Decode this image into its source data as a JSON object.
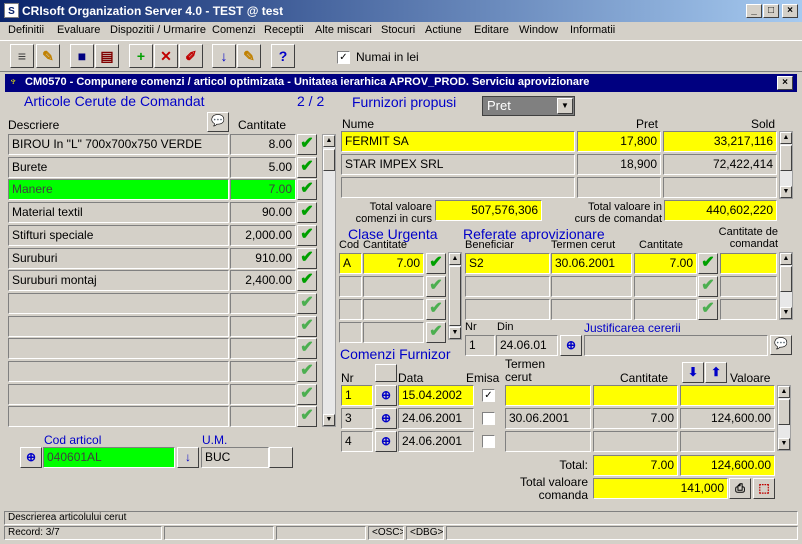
{
  "window": {
    "title": "CRIsoft Organization Server 4.0 - TEST @ test"
  },
  "menu": [
    "Definitii",
    "Evaluare",
    "Dispozitii / Urmarire",
    "Comenzi",
    "Receptii",
    "Alte miscari",
    "Stocuri",
    "Actiune",
    "Editare",
    "Window",
    "Informatii"
  ],
  "toolbar": {
    "numai_label": "Numai in lei",
    "numai_checked": "✓"
  },
  "form": {
    "title": "CM0570 - Compunere comenzi / articol optimizata - Unitatea ierarhica APROV_PROD. Serviciu aprovizionare"
  },
  "articole": {
    "title": "Articole Cerute de Comandat",
    "page": "2 / 2",
    "col_desc": "Descriere",
    "col_qty": "Cantitate",
    "rows": [
      {
        "d": "BIROU In \"L\" 700x700x750 VERDE",
        "q": "8.00"
      },
      {
        "d": "Burete",
        "q": "5.00"
      },
      {
        "d": "Manere",
        "q": "7.00"
      },
      {
        "d": "Material textil",
        "q": "90.00"
      },
      {
        "d": "Stifturi speciale",
        "q": "2,000.00"
      },
      {
        "d": "Suruburi",
        "q": "910.00"
      },
      {
        "d": "Suruburi montaj",
        "q": "2,400.00"
      },
      {
        "d": "",
        "q": ""
      },
      {
        "d": "",
        "q": ""
      },
      {
        "d": "",
        "q": ""
      },
      {
        "d": "",
        "q": ""
      },
      {
        "d": "",
        "q": ""
      },
      {
        "d": "",
        "q": ""
      }
    ],
    "cod_label": "Cod articol",
    "cod_value": "040601AL",
    "um_label": "U.M.",
    "um_value": "BUC"
  },
  "furnizori": {
    "title": "Furnizori propusi",
    "select": "Pret",
    "col_nume": "Nume",
    "col_pret": "Pret",
    "col_sold": "Sold",
    "rows": [
      {
        "n": "FERMIT SA",
        "p": "17,800",
        "s": "33,217,116"
      },
      {
        "n": "STAR IMPEX SRL",
        "p": "18,900",
        "s": "72,422,414"
      },
      {
        "n": "",
        "p": "",
        "s": ""
      }
    ],
    "tv_curs_label1": "Total valoare",
    "tv_curs_label2": "comenzi in curs",
    "tv_curs_value": "507,576,306",
    "tv_cmd_label1": "Total valoare in",
    "tv_cmd_label2": "curs de comandat",
    "tv_cmd_value": "440,602,220"
  },
  "clase": {
    "title": "Clase Urgenta",
    "col_cod": "Cod",
    "col_qty": "Cantitate",
    "rows": [
      {
        "c": "A",
        "q": "7.00"
      },
      {
        "c": "",
        "q": ""
      },
      {
        "c": "",
        "q": ""
      },
      {
        "c": "",
        "q": ""
      }
    ]
  },
  "referate": {
    "title": "Referate aprovizionare",
    "col_benef": "Beneficiar",
    "col_termen": "Termen cerut",
    "col_qty": "Cantitate",
    "col_cmd1": "Cantitate de",
    "col_cmd2": "comandat",
    "rows": [
      {
        "b": "S2",
        "t": "30.06.2001",
        "q": "7.00",
        "c": ""
      },
      {
        "b": "",
        "t": "",
        "q": "",
        "c": ""
      },
      {
        "b": "",
        "t": "",
        "q": "",
        "c": ""
      }
    ],
    "nr_label": "Nr",
    "nr_value": "1",
    "din_label": "Din",
    "din_value": "24.06.01",
    "just_label": "Justificarea cererii",
    "just_value": ""
  },
  "comenzi": {
    "title": "Comenzi Furnizor",
    "col_nr": "Nr",
    "col_data": "Data",
    "col_emisa": "Emisa",
    "col_termen1": "Termen",
    "col_termen2": "cerut",
    "col_qty": "Cantitate",
    "col_val": "Valoare",
    "rows": [
      {
        "nr": "1",
        "d": "15.04.2002",
        "e": "✓",
        "t": "",
        "q": "",
        "v": ""
      },
      {
        "nr": "3",
        "d": "24.06.2001",
        "e": "",
        "t": "30.06.2001",
        "q": "7.00",
        "v": "124,600.00"
      },
      {
        "nr": "4",
        "d": "24.06.2001",
        "e": "",
        "t": "",
        "q": "",
        "v": ""
      }
    ],
    "total_label": "Total:",
    "total_qty": "7.00",
    "total_val": "124,600.00",
    "tvc_label1": "Total valoare",
    "tvc_label2": "comanda",
    "tvc_value": "141,000"
  },
  "status": {
    "line1": "Descrierea articolului cerut",
    "record": "Record: 3/7",
    "osc": "<OSC>",
    "dbg": "<DBG>"
  }
}
